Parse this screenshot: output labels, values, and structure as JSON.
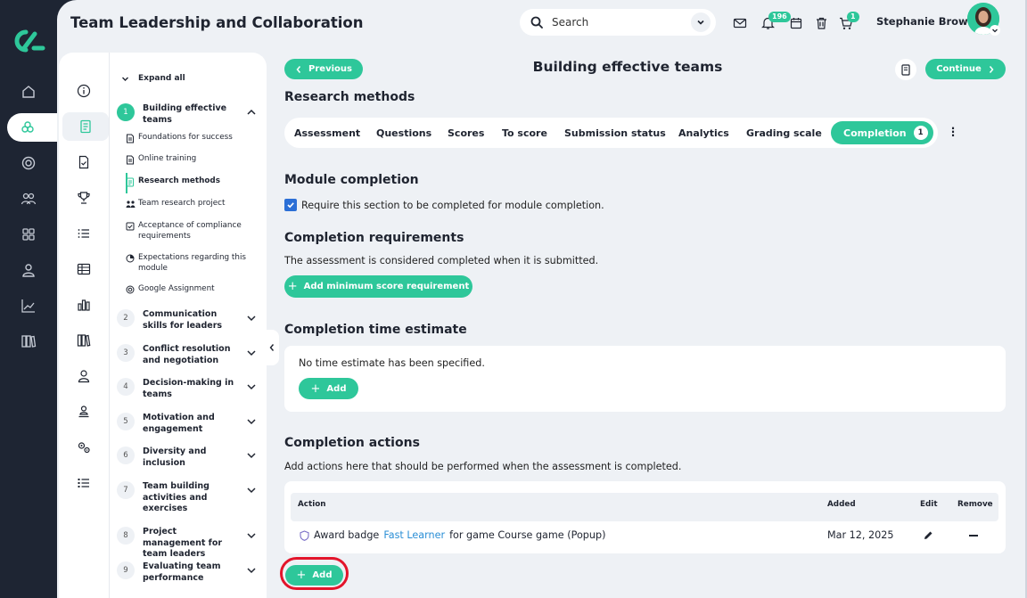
{
  "app": {
    "title": "Team Leadership and Collaboration",
    "user_name": "Stephanie Brown"
  },
  "search": {
    "placeholder": "Search"
  },
  "badges": {
    "notifications": "196",
    "cart": "1"
  },
  "sidebar": {
    "expand_all": "Expand all",
    "modules": [
      {
        "num": "1",
        "title": "Building effective teams",
        "expanded": true
      },
      {
        "num": "2",
        "title": "Communication skills for leaders"
      },
      {
        "num": "3",
        "title": "Conflict resolution and negotiation"
      },
      {
        "num": "4",
        "title": "Decision-making in teams"
      },
      {
        "num": "5",
        "title": "Motivation and engagement"
      },
      {
        "num": "6",
        "title": "Diversity and inclusion"
      },
      {
        "num": "7",
        "title": "Team building activities and exercises"
      },
      {
        "num": "8",
        "title": "Project management for team leaders"
      },
      {
        "num": "9",
        "title": "Evaluating team performance"
      }
    ],
    "sections": [
      {
        "label": "Foundations for success",
        "icon": "document-icon"
      },
      {
        "label": "Online training",
        "icon": "document-icon"
      },
      {
        "label": "Research methods",
        "icon": "assessment-icon",
        "selected": true
      },
      {
        "label": "Team research project",
        "icon": "group-icon"
      },
      {
        "label": "Acceptance of compliance requirements",
        "icon": "checkbox-icon"
      },
      {
        "label": "Expectations regarding this module",
        "icon": "pie-chart-icon"
      },
      {
        "label": "Google Assignment",
        "icon": "google-icon"
      }
    ]
  },
  "nav": {
    "previous": "Previous",
    "continue": "Continue",
    "page_title": "Building effective teams"
  },
  "section": {
    "title": "Research methods"
  },
  "tabs": [
    {
      "label": "Assessment"
    },
    {
      "label": "Questions"
    },
    {
      "label": "Scores"
    },
    {
      "label": "To score"
    },
    {
      "label": "Submission status"
    },
    {
      "label": "Analytics"
    },
    {
      "label": "Grading scale"
    },
    {
      "label": "Completion",
      "count": "1",
      "active": true
    }
  ],
  "module_completion": {
    "title": "Module completion",
    "checkbox_label": "Require this section to be completed for module completion.",
    "checked": true
  },
  "requirements": {
    "title": "Completion requirements",
    "description": "The assessment is considered completed when it is submitted.",
    "button": "Add minimum score requirement"
  },
  "time_estimate": {
    "title": "Completion time estimate",
    "empty_text": "No time estimate has been specified.",
    "button": "Add"
  },
  "actions": {
    "title": "Completion actions",
    "description": "Add actions here that should be performed when the assessment is completed.",
    "columns": {
      "action": "Action",
      "added": "Added",
      "edit": "Edit",
      "remove": "Remove"
    },
    "rows": [
      {
        "prefix": "Award badge",
        "badge_link": "Fast Learner",
        "suffix": "for game Course game (Popup)",
        "added": "Mar 12, 2025"
      }
    ],
    "add_button": "Add"
  },
  "colors": {
    "accent": "#2ec79a",
    "dark": "#1e2533",
    "background": "#eef1f5",
    "checkbox": "#2b6fd6",
    "link": "#2b8fd6",
    "highlight_ring": "#e3152b"
  }
}
